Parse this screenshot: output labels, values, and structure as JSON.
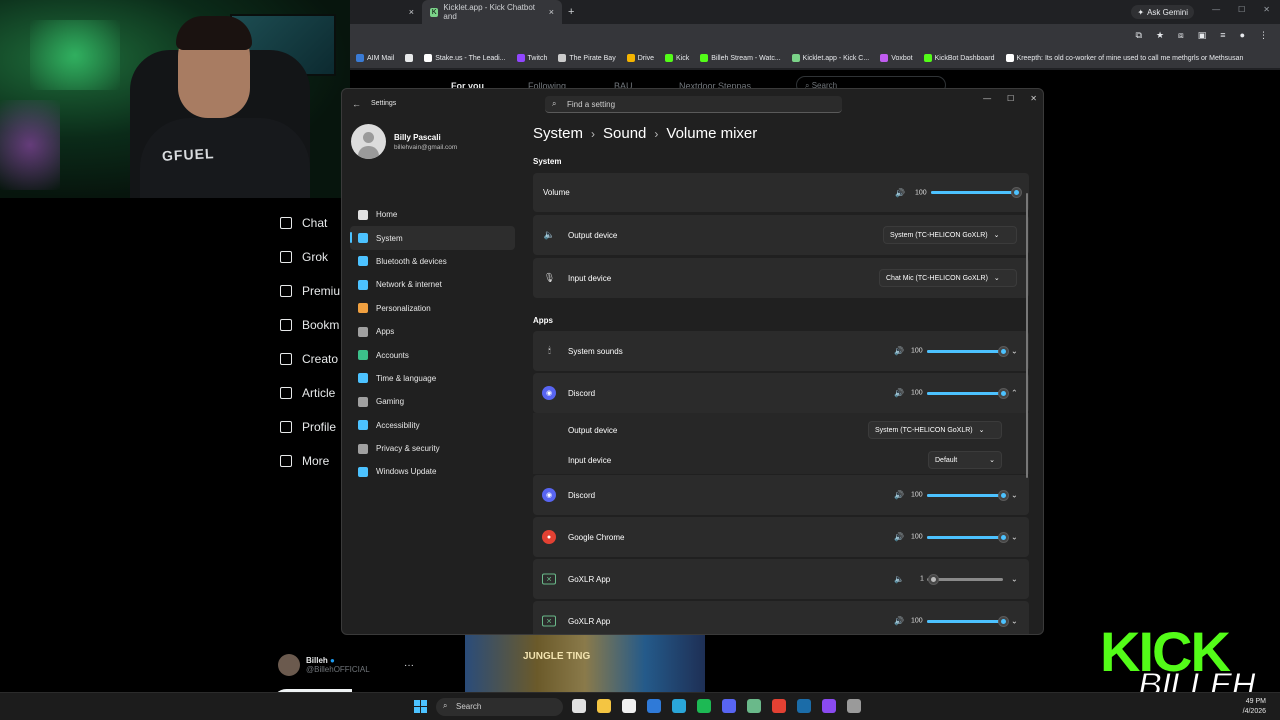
{
  "browser": {
    "tabs": [
      {
        "label": "",
        "active": false
      },
      {
        "label": "Kicklet.app - Kick Chatbot and",
        "active": true
      }
    ],
    "new_tab": "+",
    "close_glyph": "×",
    "ask_gemini": "Ask Gemini",
    "bookmarks": [
      {
        "label": "AIM Mail",
        "color": "#3a7bd5"
      },
      {
        "label": "",
        "color": "#e7e9ea",
        "icon": "x-icon"
      },
      {
        "label": "Stake.us - The Leadi...",
        "color": "#ffffff"
      },
      {
        "label": "Twitch",
        "color": "#9146ff"
      },
      {
        "label": "The Pirate Bay",
        "color": "#cccccc"
      },
      {
        "label": "Drive",
        "color": "#f4b400"
      },
      {
        "label": "Kick",
        "color": "#53fc18"
      },
      {
        "label": "Billeh Stream - Watc...",
        "color": "#53fc18"
      },
      {
        "label": "Kicklet.app - Kick C...",
        "color": "#7bd389"
      },
      {
        "label": "Voxbot",
        "color": "#c05cf0"
      },
      {
        "label": "KickBot Dashboard",
        "color": "#53fc18"
      },
      {
        "label": "Kreepth: Its old co-worker of mine used to call me methgrls or Methsusan",
        "color": "#ffffff"
      }
    ],
    "site_tabs": [
      "For you",
      "Following",
      "BAU",
      "Nextdoor Steppas"
    ],
    "site_search": "Search"
  },
  "x_sidebar": {
    "items": [
      {
        "label": "Chat",
        "icon": "chat-icon"
      },
      {
        "label": "Grok",
        "icon": "grok-icon"
      },
      {
        "label": "Premiu",
        "icon": "premium-icon"
      },
      {
        "label": "Bookm",
        "icon": "bookmark-icon"
      },
      {
        "label": "Creato",
        "icon": "creator-icon"
      },
      {
        "label": "Article",
        "icon": "article-icon"
      },
      {
        "label": "Profile",
        "icon": "profile-icon"
      },
      {
        "label": "More",
        "icon": "more-icon"
      }
    ],
    "post_button": "Po",
    "profile_name": "Billeh",
    "profile_handle": "@BillehOFFICIAL",
    "more_glyph": "···"
  },
  "webcam": {
    "shirt_text": "GFUEL"
  },
  "settings": {
    "window_title": "Settings",
    "search_placeholder": "Find a setting",
    "user": {
      "name": "Billy Pascali",
      "email": "billehvain@gmail.com"
    },
    "nav": [
      {
        "label": "Home",
        "icon": "home-icon",
        "color": "#e0e0e0",
        "selected": false
      },
      {
        "label": "System",
        "icon": "system-icon",
        "color": "#4cc2ff",
        "selected": true
      },
      {
        "label": "Bluetooth & devices",
        "icon": "bluetooth-icon",
        "color": "#4cc2ff",
        "selected": false
      },
      {
        "label": "Network & internet",
        "icon": "wifi-icon",
        "color": "#4cc2ff",
        "selected": false
      },
      {
        "label": "Personalization",
        "icon": "brush-icon",
        "color": "#f0a040",
        "selected": false
      },
      {
        "label": "Apps",
        "icon": "apps-icon",
        "color": "#a0a0a0",
        "selected": false
      },
      {
        "label": "Accounts",
        "icon": "accounts-icon",
        "color": "#3cc08a",
        "selected": false
      },
      {
        "label": "Time & language",
        "icon": "globe-icon",
        "color": "#4cc2ff",
        "selected": false
      },
      {
        "label": "Gaming",
        "icon": "gaming-icon",
        "color": "#a0a0a0",
        "selected": false
      },
      {
        "label": "Accessibility",
        "icon": "accessibility-icon",
        "color": "#4cc2ff",
        "selected": false
      },
      {
        "label": "Privacy & security",
        "icon": "shield-icon",
        "color": "#a0a0a0",
        "selected": false
      },
      {
        "label": "Windows Update",
        "icon": "update-icon",
        "color": "#4cc2ff",
        "selected": false
      }
    ],
    "breadcrumb": [
      "System",
      "Sound",
      "Volume mixer"
    ],
    "breadcrumb_sep": "›",
    "system_section": "System",
    "volume": {
      "label": "Volume",
      "value": "100",
      "level": 1.0
    },
    "output_device": {
      "label": "Output device",
      "value": "System (TC-HELICON GoXLR)"
    },
    "input_device": {
      "label": "Input device",
      "value": "Chat Mic (TC-HELICON GoXLR)"
    },
    "apps_section": "Apps",
    "apps": [
      {
        "name": "System sounds",
        "value": "100",
        "level": 1.0,
        "logo": "speaker-icon",
        "expanded": false
      },
      {
        "name": "Discord",
        "value": "100",
        "level": 1.0,
        "logo": "discord-icon",
        "expanded": true,
        "output_label": "Output device",
        "output_value": "System (TC-HELICON GoXLR)",
        "input_label": "Input device",
        "input_value": "Default"
      },
      {
        "name": "Discord",
        "value": "100",
        "level": 1.0,
        "logo": "discord-icon",
        "expanded": false
      },
      {
        "name": "Google Chrome",
        "value": "100",
        "level": 1.0,
        "logo": "chrome-icon",
        "expanded": false
      },
      {
        "name": "GoXLR App",
        "value": "1",
        "level": 0.01,
        "logo": "goxlr-icon",
        "expanded": false
      },
      {
        "name": "GoXLR App",
        "value": "100",
        "level": 1.0,
        "logo": "goxlr-icon",
        "expanded": false
      }
    ]
  },
  "taskbar": {
    "search": "Search",
    "time": "49 PM",
    "date": "/4/2026",
    "apps": [
      {
        "name": "task-view-icon",
        "color": "#e0e0e0"
      },
      {
        "name": "file-explorer-icon",
        "color": "#f4c542"
      },
      {
        "name": "store-icon",
        "color": "#f0f0f0"
      },
      {
        "name": "outlook-icon",
        "color": "#2f7ad8"
      },
      {
        "name": "edge-icon",
        "color": "#2aa6d8"
      },
      {
        "name": "spotify-icon",
        "color": "#1db954"
      },
      {
        "name": "discord-icon",
        "color": "#5865f2"
      },
      {
        "name": "goxlr-icon",
        "color": "#6ab98a"
      },
      {
        "name": "chrome-icon",
        "color": "#e34133"
      },
      {
        "name": "steam-icon",
        "color": "#1b6ca8"
      },
      {
        "name": "obs-icon",
        "color": "#8a4af0"
      },
      {
        "name": "settings-icon",
        "color": "#9a9a9a"
      }
    ]
  },
  "thumbnail": {
    "text": "JUNGLE TING"
  },
  "kick_logo": {
    "word": "KICK",
    "sub": "BILLEH",
    "color": "#53fc18"
  }
}
